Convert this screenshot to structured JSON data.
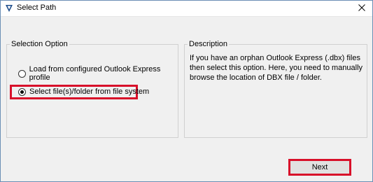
{
  "window": {
    "title": "Select Path"
  },
  "selection_group": {
    "legend": "Selection Option",
    "options": [
      {
        "label": "Load from configured Outlook Express profile",
        "selected": false
      },
      {
        "label": "Select file(s)/folder from file system",
        "selected": true
      }
    ]
  },
  "description_group": {
    "legend": "Description",
    "text": "If you have an orphan Outlook Express (.dbx) files then select this option. Here, you need to manually browse the location of DBX file / folder."
  },
  "buttons": {
    "next_label": "Next"
  },
  "colors": {
    "highlight": "#d8102a",
    "icon": "#1f4e8c"
  },
  "icons": {
    "app": "app-logo-icon",
    "close": "close-icon"
  }
}
